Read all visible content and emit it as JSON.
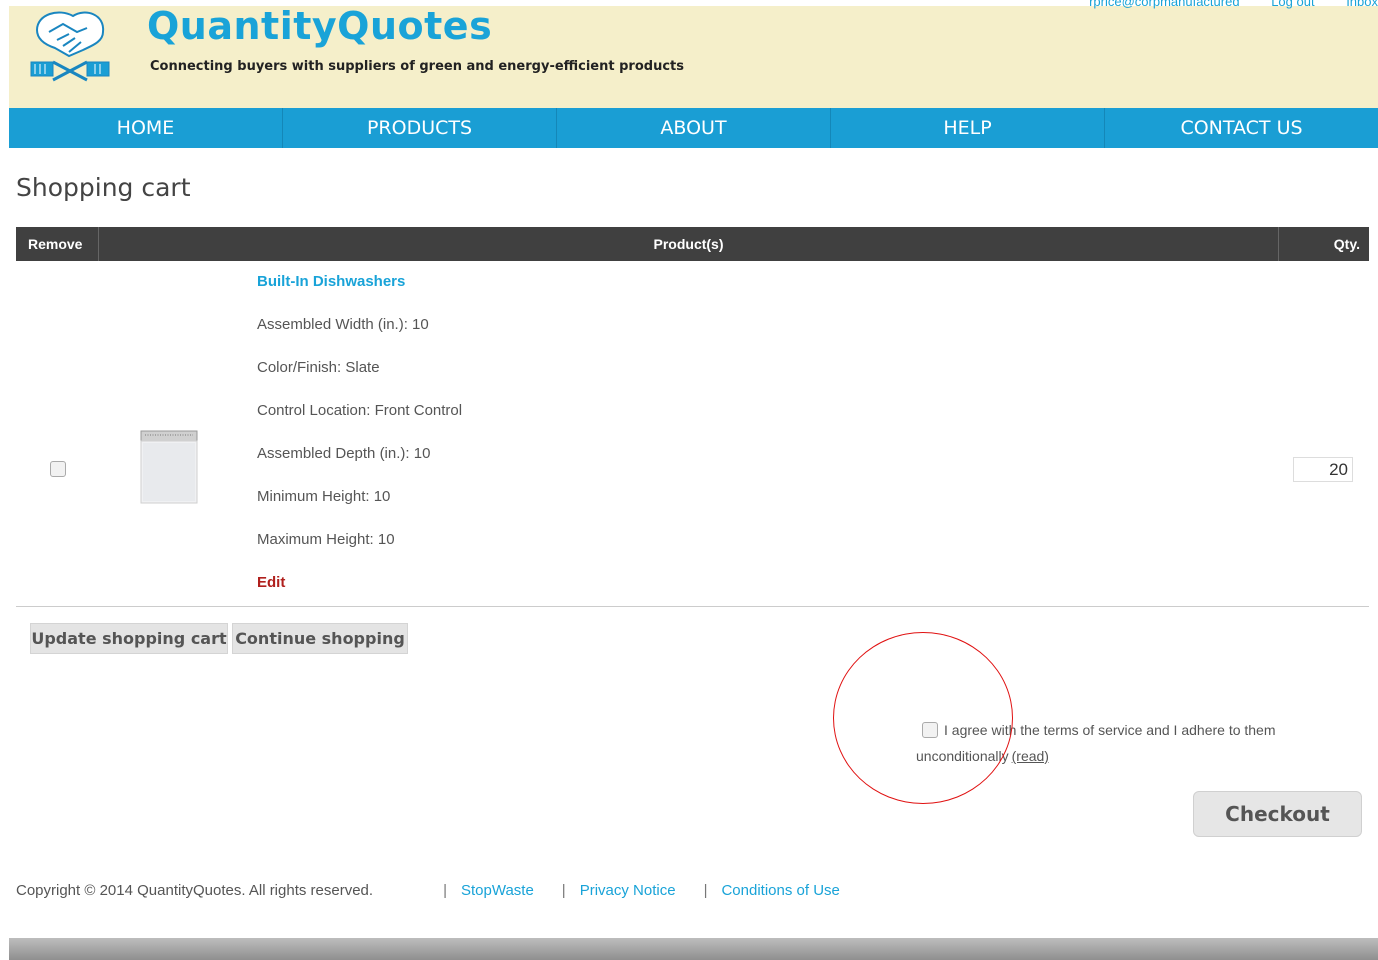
{
  "header": {
    "brand": "QuantityQuotes",
    "tagline": "Connecting buyers with suppliers of green and energy-efficient products",
    "top_links": [
      "rprice@corpmanufactured",
      "Log out",
      "Inbox"
    ]
  },
  "nav": {
    "items": [
      "HOME",
      "PRODUCTS",
      "ABOUT",
      "HELP",
      "CONTACT US"
    ]
  },
  "page": {
    "title": "Shopping cart"
  },
  "table": {
    "headers": {
      "remove": "Remove",
      "product": "Product(s)",
      "qty": "Qty."
    },
    "rows": [
      {
        "product_name": "Built-In Dishwashers",
        "attributes": [
          "Assembled Width (in.): 10",
          "Color/Finish: Slate",
          "Control Location: Front Control",
          "Assembled Depth (in.): 10",
          "Minimum Height: 10",
          "Maximum Height: 10"
        ],
        "edit_label": "Edit",
        "qty": "20"
      }
    ]
  },
  "buttons": {
    "update": "Update shopping cart",
    "continue": "Continue shopping",
    "checkout": "Checkout"
  },
  "terms": {
    "text": "I agree with the terms of service and I adhere to them unconditionally",
    "read_label": "(read)"
  },
  "footer": {
    "copyright": "Copyright © 2014 QuantityQuotes. All rights reserved.",
    "separator": "|",
    "links": [
      "StopWaste",
      "Privacy Notice",
      "Conditions of Use"
    ]
  },
  "colors": {
    "brand_blue": "#1a9ed4",
    "header_bg": "#f5efca",
    "table_header": "#404040",
    "edit_red": "#b0201d",
    "annotation_red": "#e01010"
  }
}
